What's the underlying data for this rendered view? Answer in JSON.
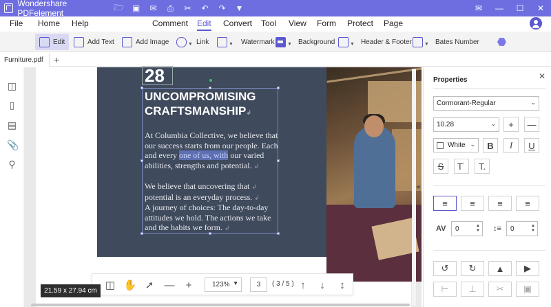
{
  "app": {
    "title": "Wondershare PDFelement"
  },
  "menu": {
    "file": "File",
    "home": "Home",
    "help": "Help",
    "comment": "Comment",
    "edit": "Edit",
    "convert": "Convert",
    "tool": "Tool",
    "view": "View",
    "form": "Form",
    "protect": "Protect",
    "page": "Page"
  },
  "toolbar": {
    "edit": "Edit",
    "add_text": "Add Text",
    "add_image": "Add Image",
    "link": "Link",
    "watermark": "Watermark",
    "background": "Background",
    "header_footer": "Header & Footer",
    "bates_number": "Bates Number"
  },
  "tab": {
    "name": "Furniture.pdf"
  },
  "document": {
    "number": "28",
    "heading_line1": "UNCOMPROMISING",
    "heading_line2": "CRAFTSMANSHIP",
    "p1_l1": "At Columbia Collective, we believe that",
    "p1_l2": "our success starts from our people. Each",
    "p1_l3_pre": "and every ",
    "p1_l3_hl": "one of us, with",
    "p1_l3_post": " our varied",
    "p1_l4": "abilities, strengths and potential.",
    "p2_l1": "We believe that uncovering that",
    "p2_l2": "potential is an everyday process.",
    "p2_l3": "A journey of choices: The day-to-day",
    "p2_l4": "attitudes we hold. The actions we take",
    "p2_l5": "and the habits we form.",
    "para_mark": "↲"
  },
  "status": {
    "dimensions": "21.59 x 27.94 cm",
    "zoom": "123%",
    "page_input": "3",
    "page_count": "( 3 / 5 )"
  },
  "properties": {
    "title": "Properties",
    "font": "Cormorant-Regular",
    "size": "10.28",
    "color_label": "White",
    "char_spacing": "0",
    "line_spacing": "0"
  },
  "colors": {
    "accent": "#6f6ee0",
    "page_dark": "#3f4a5c",
    "highlight": "#5d6fb0"
  }
}
